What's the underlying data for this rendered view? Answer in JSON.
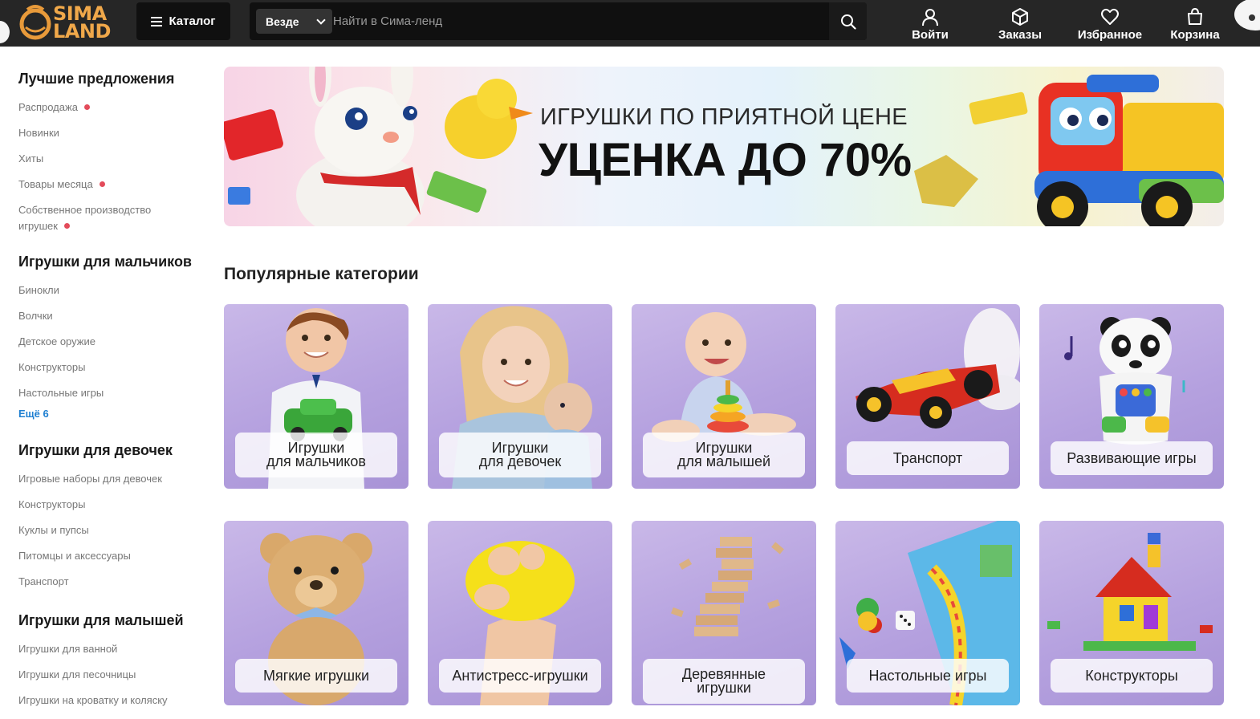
{
  "header": {
    "logo_line1": "SIMA",
    "logo_line2": "LAND",
    "catalog_label": "Каталог",
    "search_scope": "Везде",
    "search_placeholder": "Найти в Сима-ленд",
    "actions": [
      {
        "label": "Войти",
        "icon": "user-icon"
      },
      {
        "label": "Заказы",
        "icon": "box-icon"
      },
      {
        "label": "Избранное",
        "icon": "heart-icon"
      },
      {
        "label": "Корзина",
        "icon": "bag-icon"
      }
    ]
  },
  "sidebar": {
    "sections": [
      {
        "title": "Лучшие предложения",
        "items": [
          {
            "label": "Распродажа",
            "dot": true
          },
          {
            "label": "Новинки",
            "dot": false
          },
          {
            "label": "Хиты",
            "dot": false
          },
          {
            "label": "Товары месяца",
            "dot": true
          },
          {
            "label": "Собственное производство",
            "label2": "игрушек",
            "dot": true
          }
        ]
      },
      {
        "title": "Игрушки для мальчиков",
        "items": [
          {
            "label": "Бинокли"
          },
          {
            "label": "Волчки"
          },
          {
            "label": "Детское оружие"
          },
          {
            "label": "Конструкторы"
          },
          {
            "label": "Настольные игры"
          }
        ],
        "more": "Ещё 6"
      },
      {
        "title": "Игрушки для девочек",
        "items": [
          {
            "label": "Игровые наборы для девочек"
          },
          {
            "label": "Конструкторы"
          },
          {
            "label": "Куклы и пупсы"
          },
          {
            "label": "Питомцы и аксессуары"
          },
          {
            "label": "Транспорт"
          }
        ]
      },
      {
        "title": "Игрушки для малышей",
        "items": [
          {
            "label": "Игрушки для ванной"
          },
          {
            "label": "Игрушки для песочницы"
          },
          {
            "label": "Игрушки на кроватку и коляску"
          }
        ]
      }
    ]
  },
  "banner": {
    "subtitle": "ИГРУШКИ ПО ПРИЯТНОЙ ЦЕНЕ",
    "headline": "УЦЕНКА ДО 70%"
  },
  "popular": {
    "title": "Популярные категории",
    "cards": [
      {
        "line1": "Игрушки",
        "line2": "для мальчиков"
      },
      {
        "line1": "Игрушки",
        "line2": "для девочек"
      },
      {
        "line1": "Игрушки",
        "line2": "для малышей"
      },
      {
        "line1": "Транспорт"
      },
      {
        "line1": "Развивающие игры"
      },
      {
        "line1": "Мягкие игрушки"
      },
      {
        "line1": "Антистресс-игрушки"
      },
      {
        "line1": "Деревянные",
        "line2": "игрушки"
      },
      {
        "line1": "Настольные игры"
      },
      {
        "line1": "Конструкторы"
      }
    ]
  }
}
